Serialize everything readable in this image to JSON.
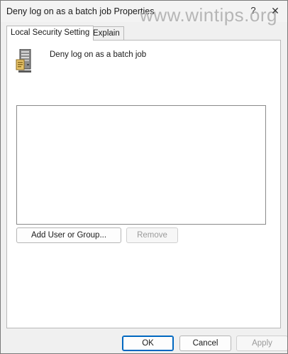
{
  "window": {
    "title": "Deny log on as a batch job Properties",
    "help_glyph": "?",
    "close_glyph": "✕",
    "watermark": "www.wintips.org"
  },
  "tabs": [
    {
      "label": "Local Security Setting",
      "active": true
    },
    {
      "label": "Explain",
      "active": false
    }
  ],
  "policy": {
    "icon": "server-policy-icon",
    "name": "Deny log on as a batch job"
  },
  "members": {
    "items": []
  },
  "buttons": {
    "add_label": "Add User or Group...",
    "remove_label": "Remove",
    "remove_enabled": false
  },
  "footer": {
    "ok_label": "OK",
    "cancel_label": "Cancel",
    "apply_label": "Apply",
    "apply_enabled": false
  },
  "colors": {
    "accent": "#0067c0",
    "window_bg": "#f0f0f0",
    "panel_bg": "#ffffff",
    "disabled_text": "#9a9a9a"
  }
}
